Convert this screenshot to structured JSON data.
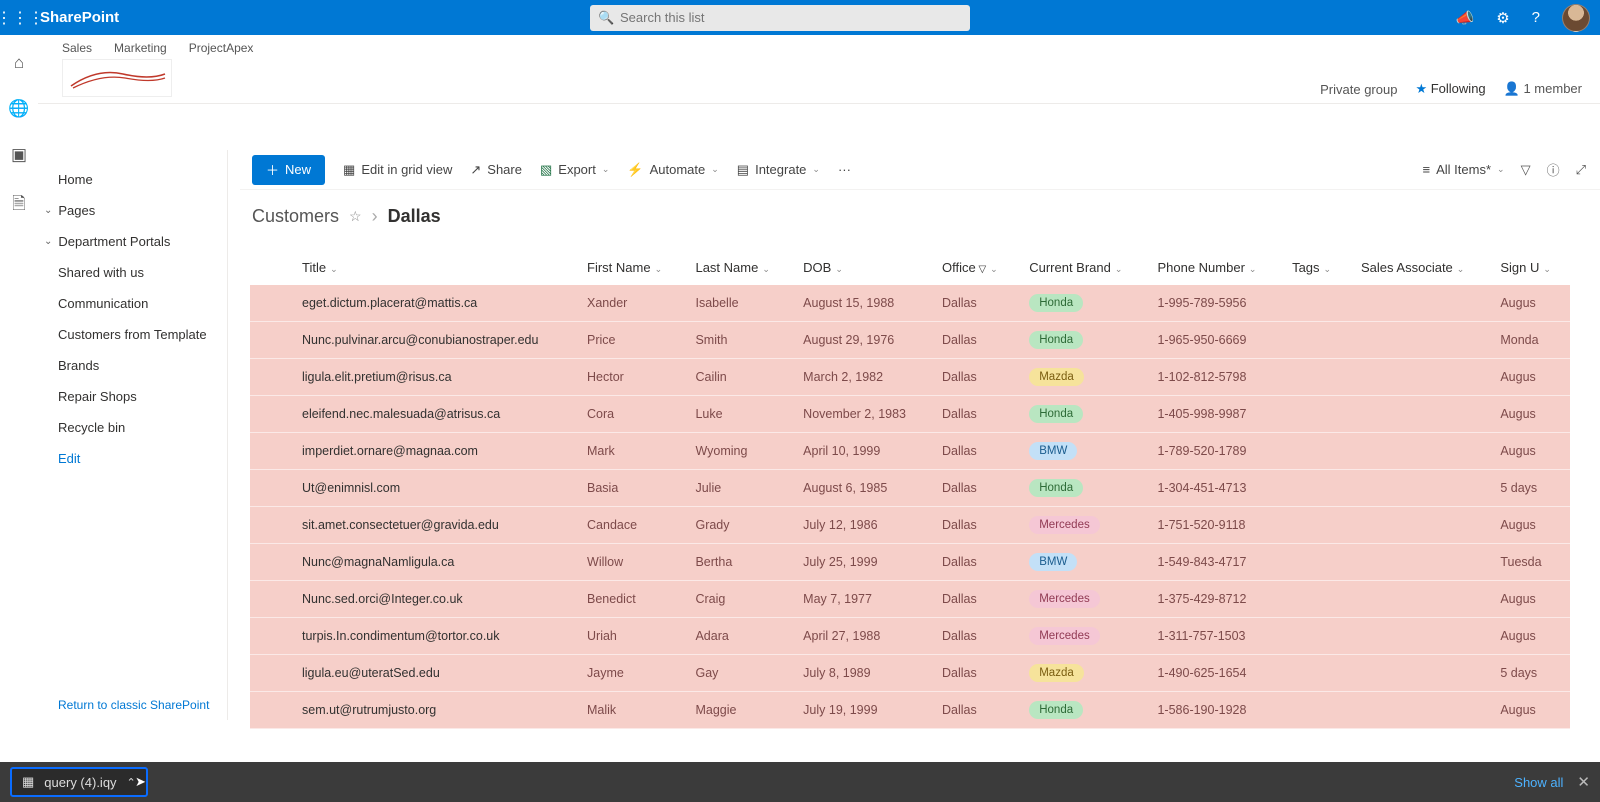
{
  "suite": {
    "title": "SharePoint",
    "search_placeholder": "Search this list"
  },
  "top_links": [
    "Sales",
    "Marketing",
    "ProjectApex"
  ],
  "group": {
    "privacy": "Private group",
    "following": "Following",
    "members": "1 member"
  },
  "sidebar": {
    "items": [
      {
        "label": "Home"
      },
      {
        "label": "Pages",
        "chev": true
      },
      {
        "label": "Department Portals",
        "chev": true
      },
      {
        "label": "Shared with us"
      },
      {
        "label": "Communication"
      },
      {
        "label": "Customers from Template"
      },
      {
        "label": "Brands"
      },
      {
        "label": "Repair Shops"
      },
      {
        "label": "Recycle bin"
      }
    ],
    "edit": "Edit",
    "return_link": "Return to classic SharePoint"
  },
  "cmd": {
    "new": "New",
    "grid": "Edit in grid view",
    "share": "Share",
    "export": "Export",
    "automate": "Automate",
    "integrate": "Integrate",
    "view": "All Items*"
  },
  "crumb": {
    "list": "Customers",
    "view": "Dallas"
  },
  "columns": [
    "Title",
    "First Name",
    "Last Name",
    "DOB",
    "Office",
    "Current Brand",
    "Phone Number",
    "Tags",
    "Sales Associate",
    "Sign U"
  ],
  "rows": [
    {
      "title": "eget.dictum.placerat@mattis.ca",
      "first": "Xander",
      "last": "Isabelle",
      "dob": "August 15, 1988",
      "office": "Dallas",
      "brand": "Honda",
      "phone": "1-995-789-5956",
      "tags": "",
      "sales": "",
      "sign": "Augus"
    },
    {
      "title": "Nunc.pulvinar.arcu@conubianostraper.edu",
      "first": "Price",
      "last": "Smith",
      "dob": "August 29, 1976",
      "office": "Dallas",
      "brand": "Honda",
      "phone": "1-965-950-6669",
      "tags": "",
      "sales": "",
      "sign": "Monda"
    },
    {
      "title": "ligula.elit.pretium@risus.ca",
      "first": "Hector",
      "last": "Cailin",
      "dob": "March 2, 1982",
      "office": "Dallas",
      "brand": "Mazda",
      "phone": "1-102-812-5798",
      "tags": "",
      "sales": "",
      "sign": "Augus"
    },
    {
      "title": "eleifend.nec.malesuada@atrisus.ca",
      "first": "Cora",
      "last": "Luke",
      "dob": "November 2, 1983",
      "office": "Dallas",
      "brand": "Honda",
      "phone": "1-405-998-9987",
      "tags": "",
      "sales": "",
      "sign": "Augus"
    },
    {
      "title": "imperdiet.ornare@magnaa.com",
      "first": "Mark",
      "last": "Wyoming",
      "dob": "April 10, 1999",
      "office": "Dallas",
      "brand": "BMW",
      "phone": "1-789-520-1789",
      "tags": "",
      "sales": "",
      "sign": "Augus"
    },
    {
      "title": "Ut@enimnisl.com",
      "first": "Basia",
      "last": "Julie",
      "dob": "August 6, 1985",
      "office": "Dallas",
      "brand": "Honda",
      "phone": "1-304-451-4713",
      "tags": "",
      "sales": "",
      "sign": "5 days"
    },
    {
      "title": "sit.amet.consectetuer@gravida.edu",
      "first": "Candace",
      "last": "Grady",
      "dob": "July 12, 1986",
      "office": "Dallas",
      "brand": "Mercedes",
      "phone": "1-751-520-9118",
      "tags": "",
      "sales": "",
      "sign": "Augus"
    },
    {
      "title": "Nunc@magnaNamligula.ca",
      "first": "Willow",
      "last": "Bertha",
      "dob": "July 25, 1999",
      "office": "Dallas",
      "brand": "BMW",
      "phone": "1-549-843-4717",
      "tags": "",
      "sales": "",
      "sign": "Tuesda"
    },
    {
      "title": "Nunc.sed.orci@Integer.co.uk",
      "first": "Benedict",
      "last": "Craig",
      "dob": "May 7, 1977",
      "office": "Dallas",
      "brand": "Mercedes",
      "phone": "1-375-429-8712",
      "tags": "",
      "sales": "",
      "sign": "Augus"
    },
    {
      "title": "turpis.In.condimentum@tortor.co.uk",
      "first": "Uriah",
      "last": "Adara",
      "dob": "April 27, 1988",
      "office": "Dallas",
      "brand": "Mercedes",
      "phone": "1-311-757-1503",
      "tags": "",
      "sales": "",
      "sign": "Augus"
    },
    {
      "title": "ligula.eu@uteratSed.edu",
      "first": "Jayme",
      "last": "Gay",
      "dob": "July 8, 1989",
      "office": "Dallas",
      "brand": "Mazda",
      "phone": "1-490-625-1654",
      "tags": "",
      "sales": "",
      "sign": "5 days"
    },
    {
      "title": "sem.ut@rutrumjusto.org",
      "first": "Malik",
      "last": "Maggie",
      "dob": "July 19, 1999",
      "office": "Dallas",
      "brand": "Honda",
      "phone": "1-586-190-1928",
      "tags": "",
      "sales": "",
      "sign": "Augus"
    }
  ],
  "download": {
    "file": "query (4).iqy",
    "show_all": "Show all"
  }
}
